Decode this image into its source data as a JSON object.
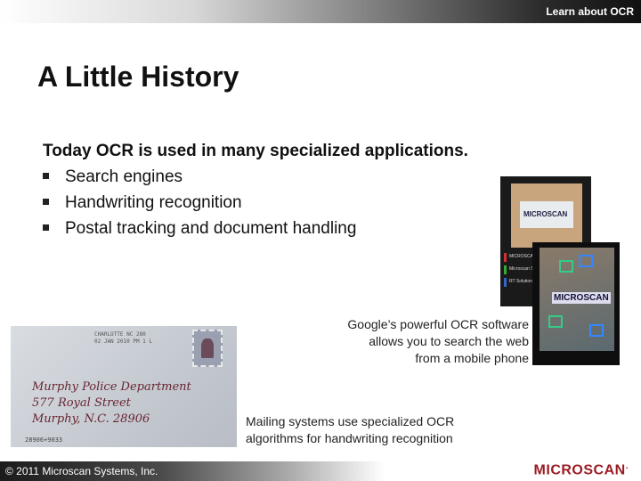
{
  "header": {
    "section": "Learn about OCR"
  },
  "slide": {
    "title": "A Little History",
    "lead": "Today OCR is used in many specialized applications.",
    "bullets": [
      "Search engines",
      "Handwriting recognition",
      "Postal tracking and document handling"
    ]
  },
  "captions": {
    "google": [
      "Google’s powerful OCR software",
      "allows you to search the web",
      "from a mobile phone"
    ],
    "mailing": [
      "Mailing systems use specialized OCR",
      "algorithms for handwriting recognition"
    ]
  },
  "envelope": {
    "postmark": [
      "CHARLOTTE NC 280",
      "02 JAN 2010 PM 1 L"
    ],
    "address": [
      "Murphy Police Department",
      "577 Royal Street",
      "Murphy, N.C. 28906"
    ],
    "barcode": "28906+9033"
  },
  "phone1": {
    "card_text": "MICROSCAN",
    "rows": [
      "MICROSCAN",
      "Microscan Sy",
      "RT Solutions I"
    ]
  },
  "phone2": {
    "card_text": "MICROSCAN"
  },
  "footer": {
    "copyright": "© 2011 Microscan Systems, Inc.",
    "logo": "MICROSCAN"
  },
  "colors": {
    "brand": "#9b1c24"
  }
}
